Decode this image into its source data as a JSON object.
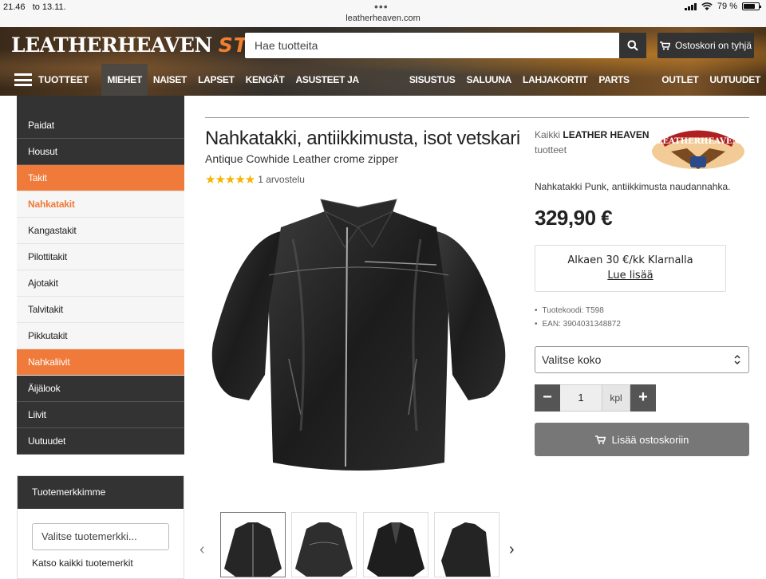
{
  "status_bar": {
    "time": "21.46",
    "date": "to 13.11.",
    "url": "leatherheaven.com",
    "battery": "79 %",
    "battery_level": 0.79
  },
  "header": {
    "logo_main": "LEATHERHEAVEN",
    "logo_sub": "STORE",
    "search_placeholder": "Hae tuotteita",
    "cart_label": "Ostoskori on tyhjä",
    "menu_label": "TUOTTEET",
    "nav": [
      "MIEHET",
      "NAISET",
      "LAPSET",
      "KENGÄT",
      "ASUSTEET JA OHEISTUOTTEET",
      "SISUSTUS",
      "SALUUNA",
      "LAHJAKORTIT",
      "PARTS EUROPE",
      "OUTLET",
      "UUTUUDET"
    ],
    "active_nav": "MIEHET"
  },
  "sidebar": {
    "items": [
      {
        "label": "Paidat",
        "style": "dark"
      },
      {
        "label": "Housut",
        "style": "dark"
      },
      {
        "label": "Takit",
        "style": "orange"
      },
      {
        "label": "Nahkatakit",
        "style": "light-selected"
      },
      {
        "label": "Kangastakit",
        "style": "light"
      },
      {
        "label": "Pilottitakit",
        "style": "light"
      },
      {
        "label": "Ajotakit",
        "style": "light"
      },
      {
        "label": "Talvitakit",
        "style": "light"
      },
      {
        "label": "Pikkutakit",
        "style": "light"
      },
      {
        "label": "Nahkaliivit",
        "style": "orange"
      },
      {
        "label": "Äijälook",
        "style": "dark"
      },
      {
        "label": "Liivit",
        "style": "dark"
      },
      {
        "label": "Uutuudet",
        "style": "dark"
      }
    ],
    "brands_title": "Tuotemerkkimme",
    "brands_select": "Valitse tuotemerkki...",
    "brands_link": "Katso kaikki tuotemerkit"
  },
  "product": {
    "title": "Nahkatakki, antiikkimusta, isot vetskari",
    "subtitle": "Antique Cowhide Leather crome zipper",
    "stars": "★★★★★",
    "rating_value": 5,
    "reviews": "1 arvostelu",
    "brand_prefix": "Kaikki",
    "brand_name": "LEATHER HEAVEN",
    "brand_suffix": "tuotteet",
    "brand_logo_text": "LEATHERHEAVEN",
    "description": "Nahkatakki Punk, antiikkimusta naudannahka.",
    "price": "329,90 €",
    "klarna_line": "Alkaen 30 €/kk Klarnalla",
    "klarna_link": "Lue lisää",
    "product_code": "Tuotekoodi: T598",
    "ean": "EAN: 3904031348872",
    "size_placeholder": "Valitse koko",
    "quantity": "1",
    "unit": "kpl",
    "add_to_cart": "Lisää ostoskoriin"
  },
  "colors": {
    "accent": "#f07a3a",
    "dark": "#333333",
    "button": "#777777",
    "star": "#f5b400"
  },
  "icons": [
    "hamburger-icon",
    "search-icon",
    "cart-icon",
    "star-icon",
    "chevron-updown-icon",
    "chevron-left-icon",
    "chevron-right-icon"
  ]
}
